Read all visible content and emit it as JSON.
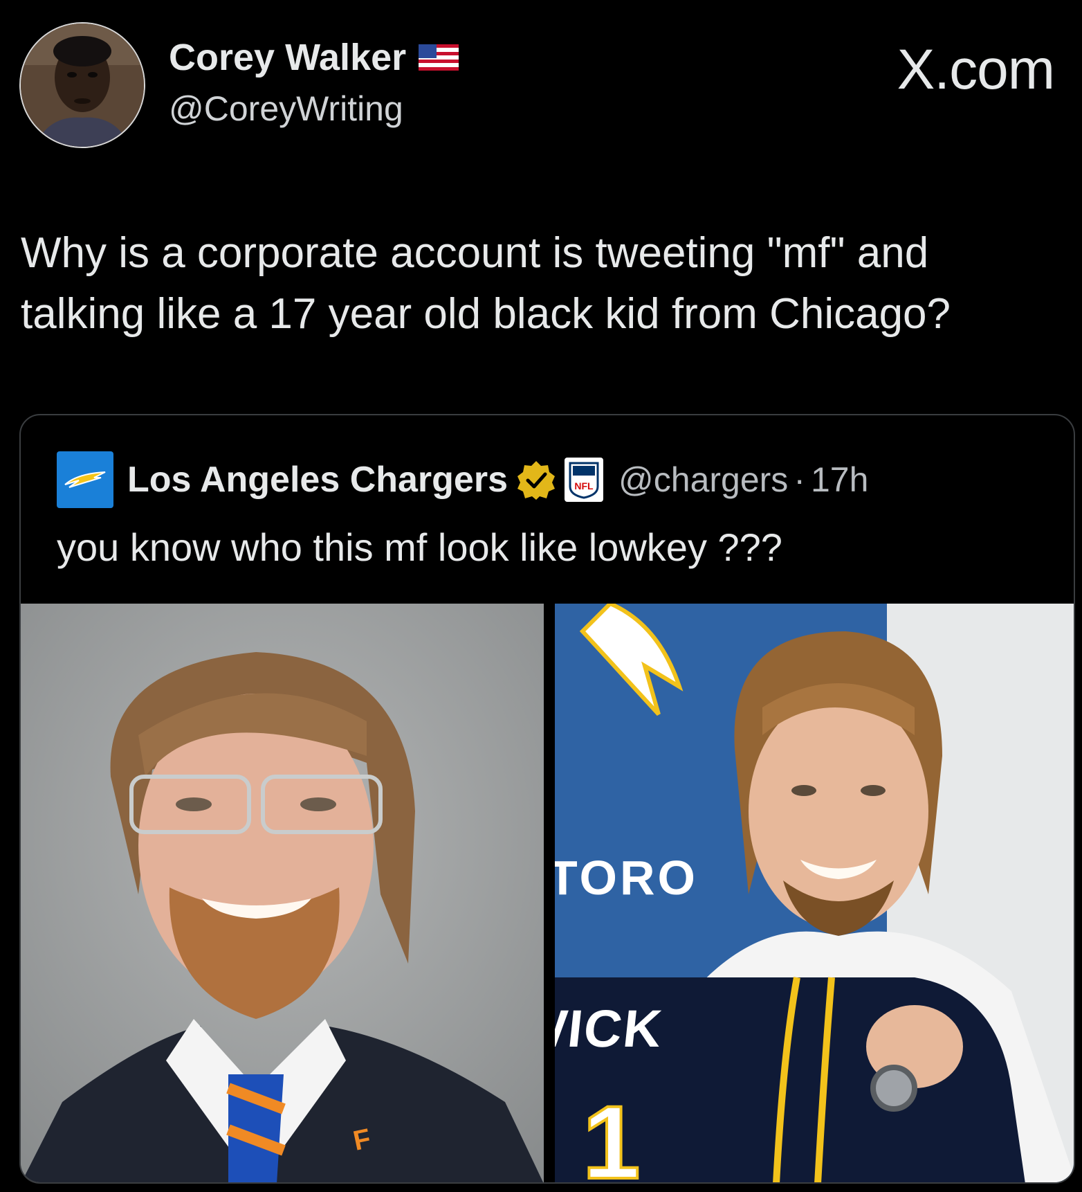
{
  "author": {
    "name": "Corey Walker",
    "handle": "@CoreyWriting",
    "flag_icon": "us-flag-icon"
  },
  "brand": "X.com",
  "tweet": {
    "line1": "Why is a corporate account is tweeting \"mf\" and",
    "line2": "talking like a 17 year old black kid from Chicago?"
  },
  "quoted_tweet": {
    "name": "Los Angeles Chargers",
    "handle": "@chargers",
    "separator": "·",
    "time": "17h",
    "text": "you know who this mf look like lowkey ???",
    "verified_color": "#e2b719",
    "logo_color": "#1a80d8"
  },
  "images": {
    "left_logo_text": "F",
    "right_banner_text": "TORO",
    "right_jersey_text": "WICK",
    "right_jersey_number": "1"
  },
  "colors": {
    "background": "#000000",
    "text": "#e7e9ea",
    "secondary": "#b8bcc0",
    "border": "#3a3d40"
  }
}
